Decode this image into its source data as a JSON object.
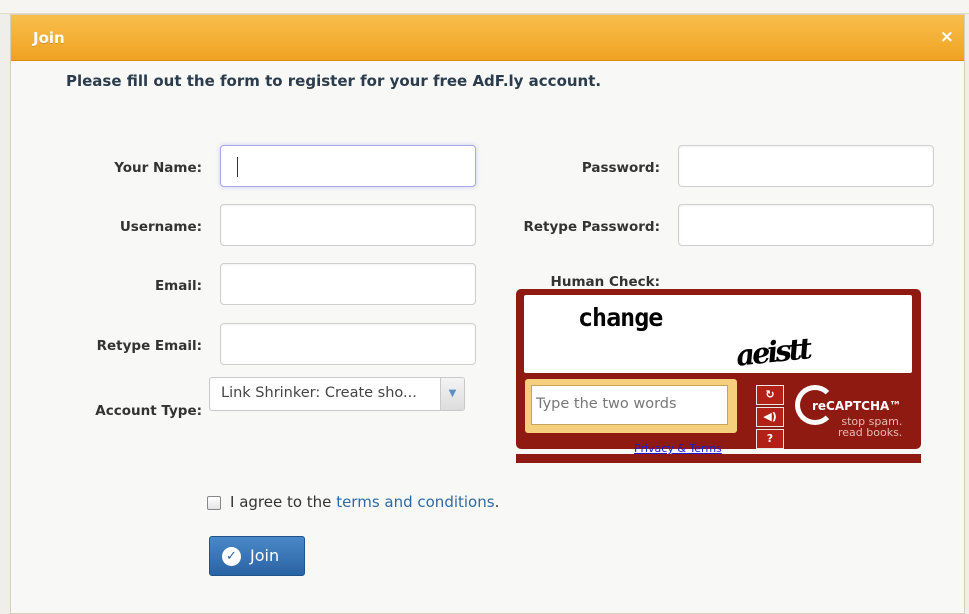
{
  "header": {
    "title": "Join",
    "close_icon": "×"
  },
  "intro": "Please fill out the form to register for your free AdF.ly account.",
  "fields": {
    "your_name": {
      "label": "Your Name:",
      "value": ""
    },
    "username": {
      "label": "Username:",
      "value": ""
    },
    "email": {
      "label": "Email:",
      "value": ""
    },
    "retype_email": {
      "label": "Retype Email:",
      "value": ""
    },
    "password": {
      "label": "Password:",
      "value": ""
    },
    "retype_password": {
      "label": "Retype Password:",
      "value": ""
    }
  },
  "account_type": {
    "label": "Account Type:",
    "selected": "Link Shrinker: Create sho..."
  },
  "captcha": {
    "label": "Human Check:",
    "word1": "change",
    "word2": "aeistt",
    "placeholder": "Type the two words",
    "privacy": "Privacy & Terms",
    "logo": "reCAPTCHA™",
    "tagline1": "stop spam.",
    "tagline2": "read books."
  },
  "agreement": {
    "prefix": "I agree to the ",
    "link": "terms and conditions",
    "suffix": ".",
    "checked": false
  },
  "submit_label": "Join",
  "colors": {
    "header": "#f0a322",
    "button": "#2a63a4",
    "captcha": "#8f1a12"
  }
}
